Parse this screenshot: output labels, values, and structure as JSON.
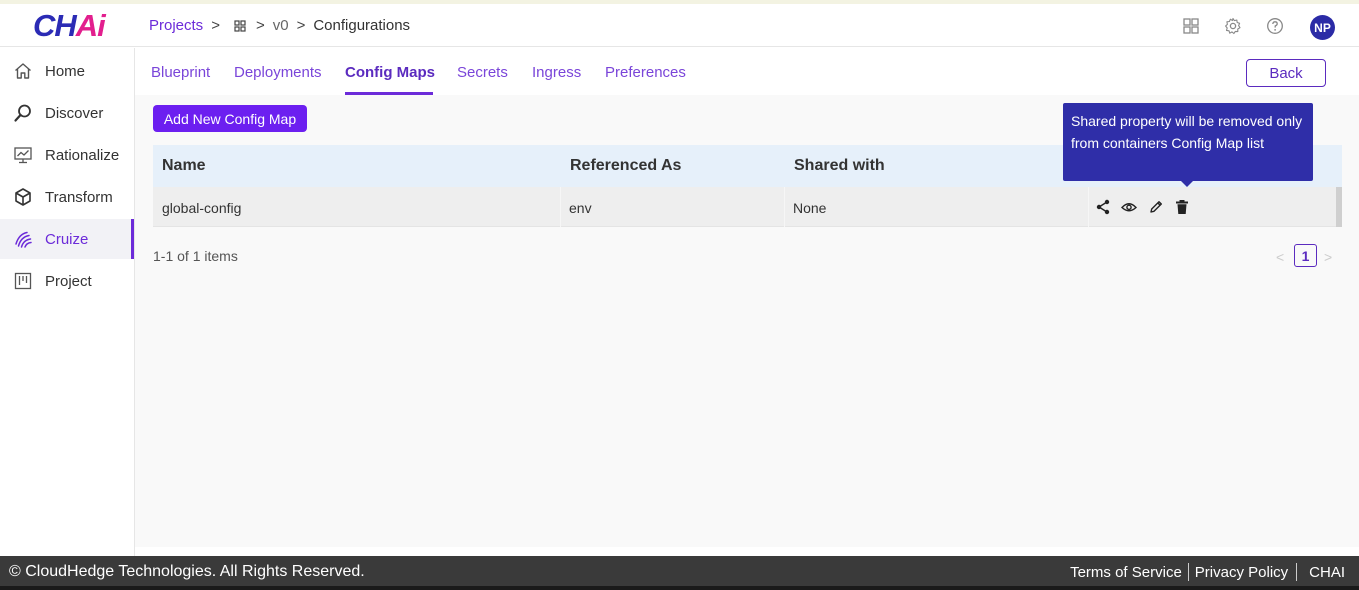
{
  "brand": {
    "logo_main": "CH",
    "logo_accent": "Ai"
  },
  "breadcrumb": {
    "projects": "Projects",
    "version": "v0",
    "current": "Configurations"
  },
  "user": {
    "initials": "NP"
  },
  "sidebar": {
    "items": [
      {
        "label": "Home",
        "icon": "home-icon"
      },
      {
        "label": "Discover",
        "icon": "search-icon"
      },
      {
        "label": "Rationalize",
        "icon": "presentation-chart-icon"
      },
      {
        "label": "Transform",
        "icon": "cube-icon"
      },
      {
        "label": "Cruize",
        "icon": "fingerprint-icon",
        "active": true
      },
      {
        "label": "Project",
        "icon": "kanban-icon"
      }
    ]
  },
  "tabs": [
    {
      "label": "Blueprint"
    },
    {
      "label": "Deployments"
    },
    {
      "label": "Config Maps",
      "active": true
    },
    {
      "label": "Secrets"
    },
    {
      "label": "Ingress"
    },
    {
      "label": "Preferences"
    }
  ],
  "toolbar": {
    "back_label": "Back",
    "add_label": "Add New Config Map"
  },
  "table": {
    "columns": [
      "Name",
      "Referenced As",
      "Shared with"
    ],
    "rows": [
      {
        "name": "global-config",
        "referenced_as": "env",
        "shared_with": "None"
      }
    ]
  },
  "tooltip": {
    "text": "Shared property will be removed only from containers Config Map list"
  },
  "pagination": {
    "summary": "1-1 of 1 items",
    "current_page": "1"
  },
  "footer": {
    "copyright": "© CloudHedge Technologies. All Rights Reserved.",
    "terms": "Terms of Service",
    "privacy": "Privacy Policy",
    "brand": "CHAI"
  },
  "colors": {
    "accent": "#6c2bd9",
    "button_primary": "#6c1ff0",
    "tooltip_bg": "#2f2ea8",
    "footer_bg": "#3a3a3a"
  }
}
